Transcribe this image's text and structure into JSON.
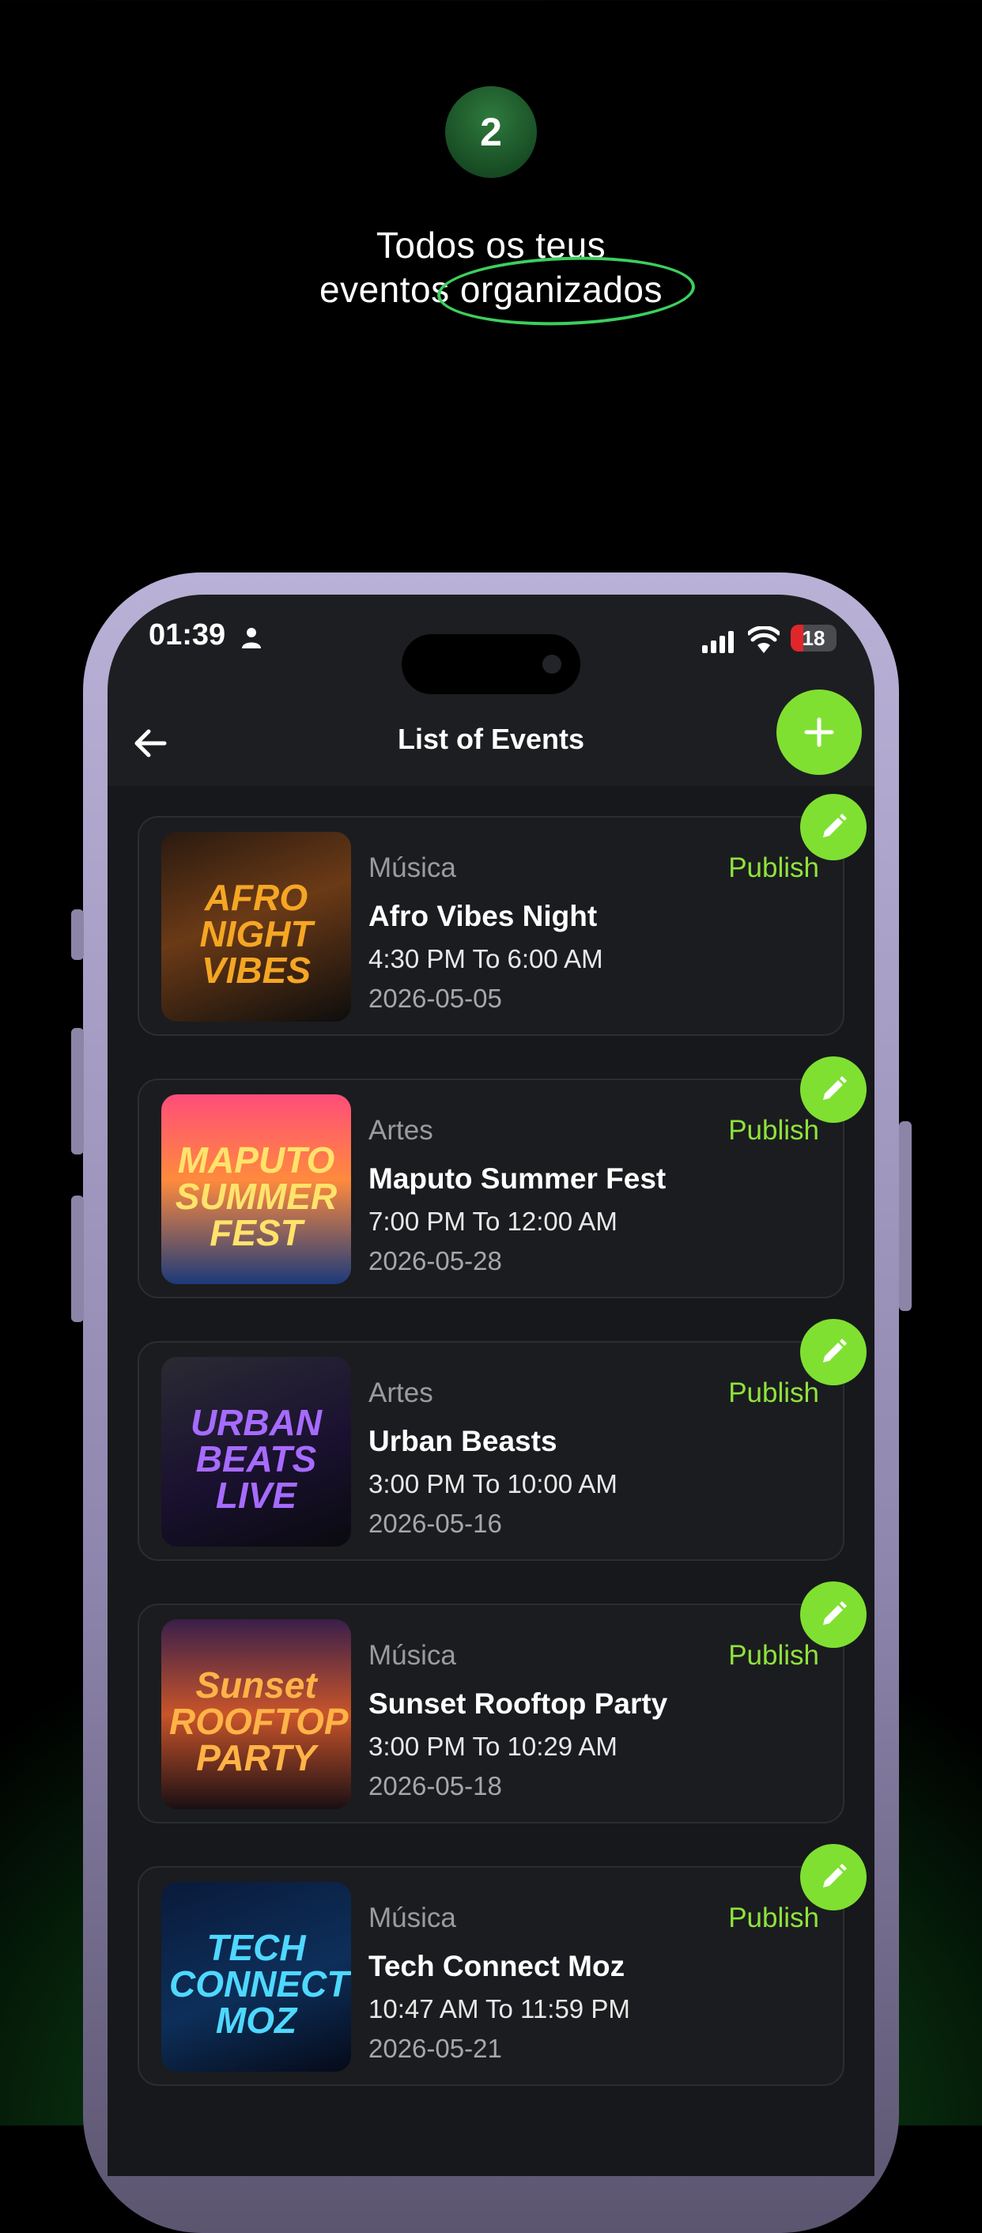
{
  "onboarding": {
    "step_number": "2",
    "headline_line1": "Todos os teus",
    "headline_line2": "eventos organizados"
  },
  "status_bar": {
    "time": "01:39",
    "battery": "18",
    "icons": [
      "person-icon",
      "signal-icon",
      "wifi-icon",
      "battery-icon"
    ]
  },
  "app_bar": {
    "title": "List of Events",
    "back_icon": "arrow-left-icon",
    "add_icon": "plus-icon"
  },
  "events": [
    {
      "category": "Música",
      "status": "Publish",
      "name": "Afro Vibes Night",
      "time_range": "4:30 PM To 6:00 AM",
      "date": "2026-05-05",
      "poster_text": "AFRO NIGHT VIBES"
    },
    {
      "category": "Artes",
      "status": "Publish",
      "name": "Maputo Summer Fest",
      "time_range": "7:00 PM To 12:00 AM",
      "date": "2026-05-28",
      "poster_text": "MAPUTO SUMMER FEST"
    },
    {
      "category": "Artes",
      "status": "Publish",
      "name": "Urban Beasts",
      "time_range": "3:00 PM To 10:00 AM",
      "date": "2026-05-16",
      "poster_text": "URBAN BEATS LIVE"
    },
    {
      "category": "Música",
      "status": "Publish",
      "name": "Sunset Rooftop Party",
      "time_range": "3:00 PM To 10:29 AM",
      "date": "2026-05-18",
      "poster_text": "Sunset ROOFTOP PARTY"
    },
    {
      "category": "Música",
      "status": "Publish",
      "name": "Tech Connect Moz",
      "time_range": "10:47 AM To 11:59 PM",
      "date": "2026-05-21",
      "poster_text": "TECH CONNECT MOZ"
    }
  ],
  "colors": {
    "accent": "#7fe032",
    "publish": "#8fe33c",
    "screen_bg": "#1d1e21",
    "card_bg": "#1b1c1f"
  }
}
